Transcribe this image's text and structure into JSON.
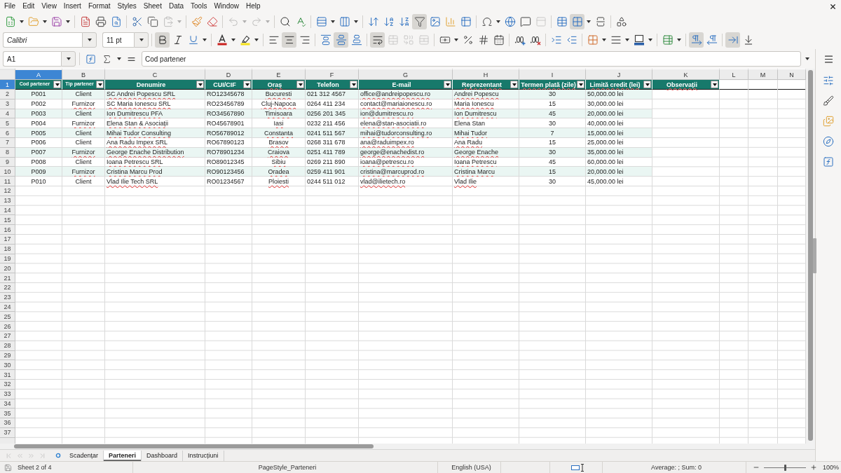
{
  "menu": [
    "File",
    "Edit",
    "View",
    "Insert",
    "Format",
    "Styles",
    "Sheet",
    "Data",
    "Tools",
    "Window",
    "Help"
  ],
  "standard_toolbar": {
    "paste_disabled": true,
    "undo_disabled": true,
    "redo_disabled": true,
    "header_footer_disabled": true,
    "autofilter_on": true,
    "freeze_on": true
  },
  "formatting_toolbar": {
    "font_name": "Calibri",
    "font_size": "11 pt",
    "bold_on": true,
    "italic_on": false,
    "underline_on": false,
    "align_left_on": false,
    "align_center_on": true,
    "align_right_on": false,
    "align_top_on": false,
    "align_middle_on": true,
    "align_bottom_on": false,
    "wrap_on": true,
    "merge_disabled": true,
    "ltr_on": true,
    "rtl_on": false,
    "text_direction_on": true,
    "vertical_text_on": false
  },
  "formula_bar": {
    "cell_reference": "A1",
    "content": "Cod partener"
  },
  "spreadsheet": {
    "columns": [
      {
        "letter": "A",
        "selected": true
      },
      {
        "letter": "B",
        "selected": false
      },
      {
        "letter": "C",
        "selected": false
      },
      {
        "letter": "D",
        "selected": false
      },
      {
        "letter": "E",
        "selected": false
      },
      {
        "letter": "F",
        "selected": false
      },
      {
        "letter": "G",
        "selected": false
      },
      {
        "letter": "H",
        "selected": false
      },
      {
        "letter": "I",
        "selected": false
      },
      {
        "letter": "J",
        "selected": false
      },
      {
        "letter": "K",
        "selected": false
      },
      {
        "letter": "L",
        "selected": false
      },
      {
        "letter": "M",
        "selected": false
      },
      {
        "letter": "N",
        "selected": false
      }
    ],
    "header_row": {
      "number": "1",
      "selected": true,
      "cells": [
        {
          "text": "Cod partener",
          "spell_error": false
        },
        {
          "text": "Tip partener",
          "spell_error": false
        },
        {
          "text": "Denumire",
          "spell_error": false
        },
        {
          "text": "CUI/CIF",
          "spell_error": false
        },
        {
          "text": "Oraș",
          "spell_error": true
        },
        {
          "text": "Telefon",
          "spell_error": false
        },
        {
          "text": "E-mail",
          "spell_error": false
        },
        {
          "text": "Reprezentant",
          "spell_error": true
        },
        {
          "text": "Termen plată (zile)",
          "spell_error": true
        },
        {
          "text": "Limită credit (lei)",
          "spell_error": true
        },
        {
          "text": "Observații",
          "spell_error": true
        }
      ]
    },
    "rows": [
      {
        "number": "2",
        "selected": false,
        "cells": [
          {
            "text": "P001",
            "spell_error": false
          },
          {
            "text": "Client",
            "spell_error": false
          },
          {
            "text": "SC Andrei Popescu SRL",
            "spell_error": true
          },
          {
            "text": "RO12345678",
            "spell_error": false
          },
          {
            "text": "Bucuresti",
            "spell_error": true
          },
          {
            "text": "021 312 4567",
            "spell_error": false
          },
          {
            "text": "office@andreipopescu.ro",
            "spell_error": true
          },
          {
            "text": "Andrei Popescu",
            "spell_error": true
          },
          {
            "text": "30",
            "spell_error": false
          },
          {
            "text": "50,000.00 lei",
            "spell_error": false
          }
        ]
      },
      {
        "number": "3",
        "selected": false,
        "cells": [
          {
            "text": "P002",
            "spell_error": false
          },
          {
            "text": "Furnizor",
            "spell_error": true
          },
          {
            "text": "SC Maria Ionescu SRL",
            "spell_error": true
          },
          {
            "text": "RO23456789",
            "spell_error": false
          },
          {
            "text": "Cluj-Napoca",
            "spell_error": true
          },
          {
            "text": "0264 411 234",
            "spell_error": false
          },
          {
            "text": "contact@mariaionescu.ro",
            "spell_error": true
          },
          {
            "text": "Maria Ionescu",
            "spell_error": true
          },
          {
            "text": "15",
            "spell_error": false
          },
          {
            "text": "30,000.00 lei",
            "spell_error": false
          }
        ]
      },
      {
        "number": "4",
        "selected": false,
        "cells": [
          {
            "text": "P003",
            "spell_error": false
          },
          {
            "text": "Client",
            "spell_error": false
          },
          {
            "text": "Ion Dumitrescu PFA",
            "spell_error": true
          },
          {
            "text": "RO34567890",
            "spell_error": false
          },
          {
            "text": "Timisoara",
            "spell_error": true
          },
          {
            "text": "0256 201 345",
            "spell_error": false
          },
          {
            "text": "ion@dumitrescu.ro",
            "spell_error": true
          },
          {
            "text": "Ion Dumitrescu",
            "spell_error": true
          },
          {
            "text": "45",
            "spell_error": false
          },
          {
            "text": "20,000.00 lei",
            "spell_error": false
          }
        ]
      },
      {
        "number": "5",
        "selected": false,
        "cells": [
          {
            "text": "P004",
            "spell_error": false
          },
          {
            "text": "Furnizor",
            "spell_error": true
          },
          {
            "text": "Elena Stan & Asociații",
            "spell_error": true
          },
          {
            "text": "RO45678901",
            "spell_error": false
          },
          {
            "text": "Iasi",
            "spell_error": true
          },
          {
            "text": "0232 211 456",
            "spell_error": false
          },
          {
            "text": "elena@stan-asociatii.ro",
            "spell_error": true
          },
          {
            "text": "Elena Stan",
            "spell_error": false
          },
          {
            "text": "30",
            "spell_error": false
          },
          {
            "text": "40,000.00 lei",
            "spell_error": false
          }
        ]
      },
      {
        "number": "6",
        "selected": false,
        "cells": [
          {
            "text": "P005",
            "spell_error": false
          },
          {
            "text": "Client",
            "spell_error": false
          },
          {
            "text": "Mihai Tudor Consulting",
            "spell_error": true
          },
          {
            "text": "RO56789012",
            "spell_error": false
          },
          {
            "text": "Constanta",
            "spell_error": true
          },
          {
            "text": "0241 511 567",
            "spell_error": false
          },
          {
            "text": "mihai@tudorconsulting.ro",
            "spell_error": true
          },
          {
            "text": "Mihai Tudor",
            "spell_error": true
          },
          {
            "text": "7",
            "spell_error": false
          },
          {
            "text": "15,000.00 lei",
            "spell_error": false
          }
        ]
      },
      {
        "number": "7",
        "selected": false,
        "cells": [
          {
            "text": "P006",
            "spell_error": false
          },
          {
            "text": "Client",
            "spell_error": false
          },
          {
            "text": "Ana Radu Impex SRL",
            "spell_error": true
          },
          {
            "text": "RO67890123",
            "spell_error": false
          },
          {
            "text": "Brasov",
            "spell_error": true
          },
          {
            "text": "0268 311 678",
            "spell_error": false
          },
          {
            "text": "ana@raduimpex.ro",
            "spell_error": true
          },
          {
            "text": "Ana Radu",
            "spell_error": true
          },
          {
            "text": "15",
            "spell_error": false
          },
          {
            "text": "25,000.00 lei",
            "spell_error": false
          }
        ]
      },
      {
        "number": "8",
        "selected": false,
        "cells": [
          {
            "text": "P007",
            "spell_error": false
          },
          {
            "text": "Furnizor",
            "spell_error": true
          },
          {
            "text": "George Enache Distribution",
            "spell_error": true
          },
          {
            "text": "RO78901234",
            "spell_error": false
          },
          {
            "text": "Craiova",
            "spell_error": true
          },
          {
            "text": "0251 411 789",
            "spell_error": false
          },
          {
            "text": "george@enachedist.ro",
            "spell_error": true
          },
          {
            "text": "George Enache",
            "spell_error": true
          },
          {
            "text": "30",
            "spell_error": false
          },
          {
            "text": "35,000.00 lei",
            "spell_error": false
          }
        ]
      },
      {
        "number": "9",
        "selected": false,
        "cells": [
          {
            "text": "P008",
            "spell_error": false
          },
          {
            "text": "Client",
            "spell_error": false
          },
          {
            "text": "Ioana Petrescu SRL",
            "spell_error": true
          },
          {
            "text": "RO89012345",
            "spell_error": false
          },
          {
            "text": "Sibiu",
            "spell_error": true
          },
          {
            "text": "0269 211 890",
            "spell_error": false
          },
          {
            "text": "ioana@petrescu.ro",
            "spell_error": true
          },
          {
            "text": "Ioana Petrescu",
            "spell_error": true
          },
          {
            "text": "45",
            "spell_error": false
          },
          {
            "text": "60,000.00 lei",
            "spell_error": false
          }
        ]
      },
      {
        "number": "10",
        "selected": false,
        "cells": [
          {
            "text": "P009",
            "spell_error": false
          },
          {
            "text": "Furnizor",
            "spell_error": true
          },
          {
            "text": "Cristina Marcu Prod",
            "spell_error": true
          },
          {
            "text": "RO90123456",
            "spell_error": false
          },
          {
            "text": "Oradea",
            "spell_error": true
          },
          {
            "text": "0259 411 901",
            "spell_error": false
          },
          {
            "text": "cristina@marcuprod.ro",
            "spell_error": true
          },
          {
            "text": "Cristina Marcu",
            "spell_error": true
          },
          {
            "text": "15",
            "spell_error": false
          },
          {
            "text": "20,000.00 lei",
            "spell_error": false
          }
        ]
      },
      {
        "number": "11",
        "selected": false,
        "cells": [
          {
            "text": "P010",
            "spell_error": false
          },
          {
            "text": "Client",
            "spell_error": false
          },
          {
            "text": "Vlad Ilie Tech SRL",
            "spell_error": true
          },
          {
            "text": "RO01234567",
            "spell_error": false
          },
          {
            "text": "Ploiesti",
            "spell_error": true
          },
          {
            "text": "0244 511 012",
            "spell_error": false
          },
          {
            "text": "vlad@ilietech.ro",
            "spell_error": true
          },
          {
            "text": "Vlad Ilie",
            "spell_error": true
          },
          {
            "text": "30",
            "spell_error": false
          },
          {
            "text": "45,000.00 lei",
            "spell_error": false
          }
        ]
      }
    ],
    "empty_rows": [
      {
        "number": "12",
        "selected": false
      },
      {
        "number": "13",
        "selected": false
      },
      {
        "number": "14",
        "selected": false
      },
      {
        "number": "15",
        "selected": false
      },
      {
        "number": "16",
        "selected": false
      },
      {
        "number": "17",
        "selected": false
      },
      {
        "number": "18",
        "selected": false
      },
      {
        "number": "19",
        "selected": false
      },
      {
        "number": "20",
        "selected": false
      },
      {
        "number": "21",
        "selected": false
      },
      {
        "number": "22",
        "selected": false
      },
      {
        "number": "23",
        "selected": false
      },
      {
        "number": "24",
        "selected": false
      },
      {
        "number": "25",
        "selected": false
      },
      {
        "number": "26",
        "selected": false
      },
      {
        "number": "27",
        "selected": false
      },
      {
        "number": "28",
        "selected": false
      },
      {
        "number": "29",
        "selected": false
      },
      {
        "number": "30",
        "selected": false
      },
      {
        "number": "31",
        "selected": false
      },
      {
        "number": "32",
        "selected": false
      },
      {
        "number": "33",
        "selected": false
      },
      {
        "number": "34",
        "selected": false
      },
      {
        "number": "35",
        "selected": false
      },
      {
        "number": "36",
        "selected": false
      },
      {
        "number": "37",
        "selected": false
      }
    ]
  },
  "sheet_nav": {
    "disabled": true
  },
  "sheet_tabs": [
    {
      "label": "Scadențar",
      "selected": false
    },
    {
      "label": "Parteneri",
      "selected": true
    },
    {
      "label": "Dashboard",
      "selected": false
    },
    {
      "label": "Instrucțiuni",
      "selected": false
    }
  ],
  "status_bar": {
    "sheet": "Sheet 2 of 4",
    "page_style": "PageStyle_Parteneri",
    "language": "English (USA)",
    "summary": "Average: ; Sum: 0",
    "zoom": {
      "level": 0.5,
      "reading": "100%"
    }
  }
}
